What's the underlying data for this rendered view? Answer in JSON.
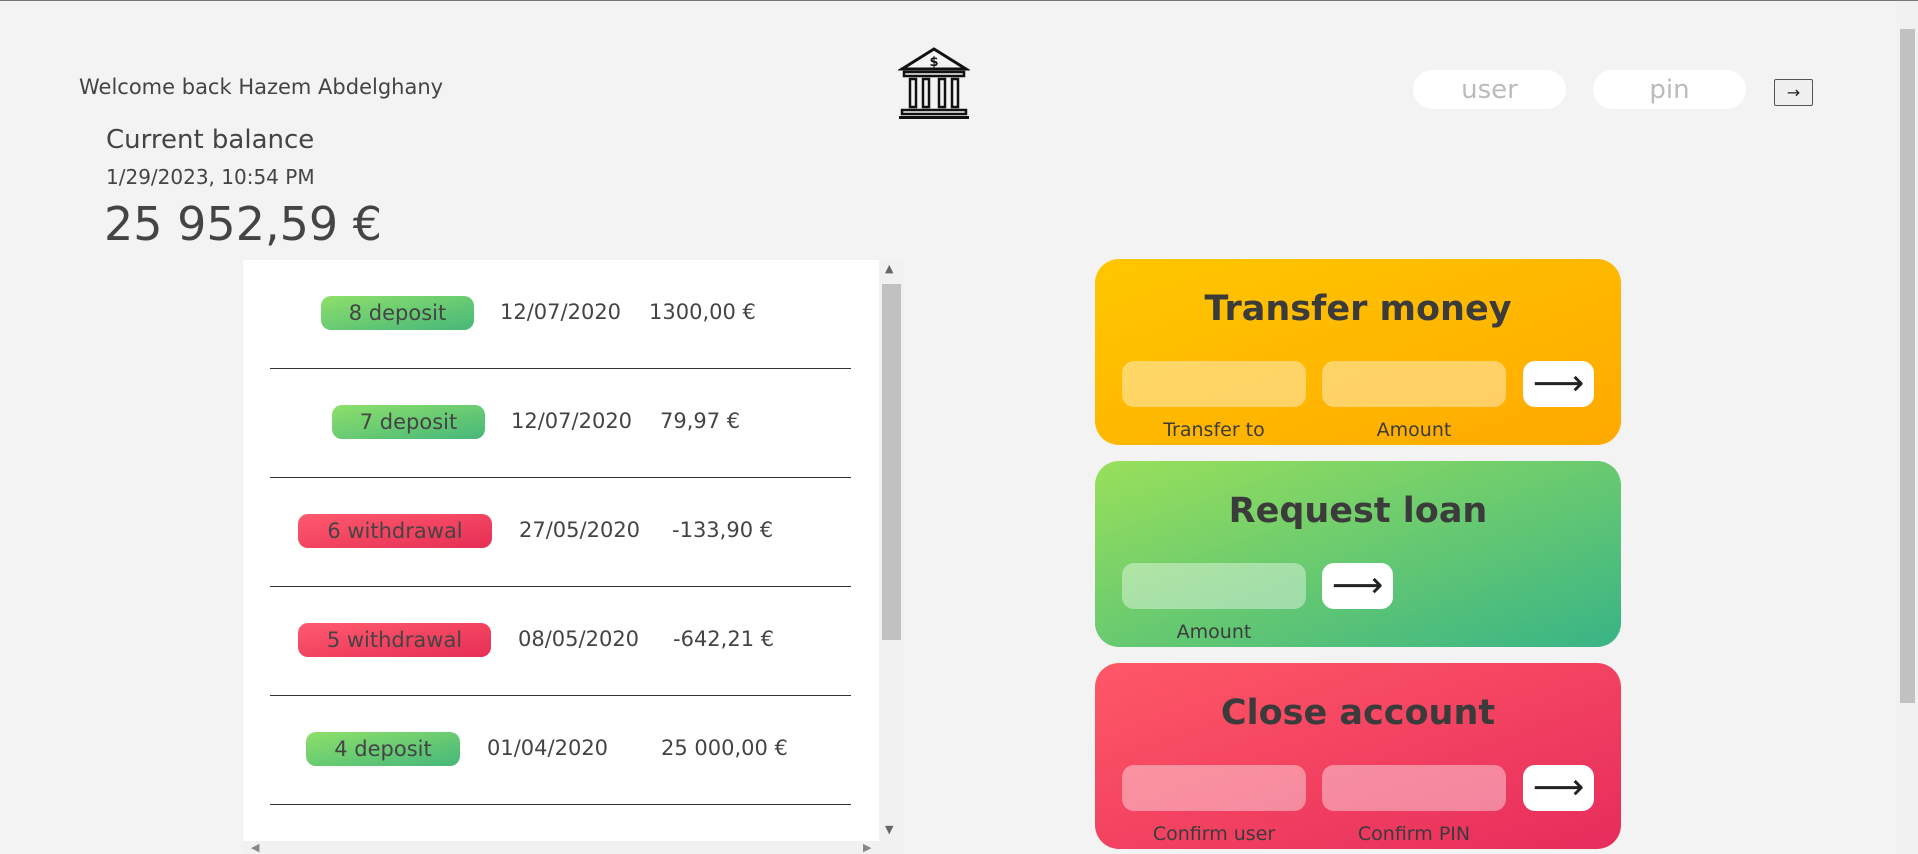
{
  "header": {
    "welcome": "Welcome back Hazem Abdelghany",
    "logo_icon": "bank-icon",
    "user_placeholder": "user",
    "pin_placeholder": "pin",
    "login_label": "→"
  },
  "balance": {
    "label": "Current balance",
    "date": "1/29/2023, 10:54 PM",
    "value": "25 952,59 €"
  },
  "movements": [
    {
      "type": "deposit",
      "label": "8 deposit",
      "date": "12/07/2020",
      "amount": "1300,00 €"
    },
    {
      "type": "deposit",
      "label": "7 deposit",
      "date": "12/07/2020",
      "amount": "79,97 €"
    },
    {
      "type": "withdrawal",
      "label": "6 withdrawal",
      "date": "27/05/2020",
      "amount": "-133,90 €"
    },
    {
      "type": "withdrawal",
      "label": "5 withdrawal",
      "date": "08/05/2020",
      "amount": "-642,21 €"
    },
    {
      "type": "deposit",
      "label": "4 deposit",
      "date": "01/04/2020",
      "amount": "25 000,00 €"
    }
  ],
  "operations": {
    "transfer": {
      "title": "Transfer money",
      "to_label": "Transfer to",
      "amount_label": "Amount",
      "button": "⟶"
    },
    "loan": {
      "title": "Request loan",
      "amount_label": "Amount",
      "button": "⟶"
    },
    "close": {
      "title": "Close account",
      "user_label": "Confirm user",
      "pin_label": "Confirm PIN",
      "button": "⟶"
    }
  },
  "colors": {
    "deposit": "#6fcf6f",
    "withdrawal": "#f0405e",
    "transfer": "#ffb800",
    "loan": "#62c76e",
    "close": "#f1435f"
  }
}
